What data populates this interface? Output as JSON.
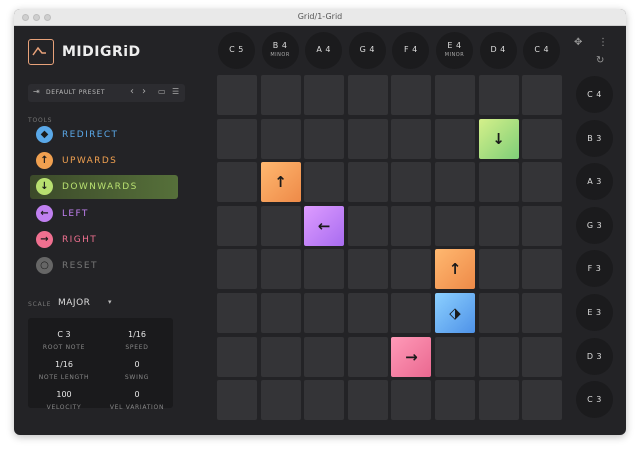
{
  "window": {
    "title": "Grid/1-Grid"
  },
  "app": {
    "logo_text": "MIDIGRiD"
  },
  "preset": {
    "label": "DEFAULT PRESET",
    "prev": "‹",
    "next": "›",
    "save": "▭",
    "menu": "☰",
    "import": "⇥"
  },
  "tools": {
    "label": "TOOLS",
    "items": [
      {
        "label": "REDIRECT",
        "glyph": "◆",
        "color": "#5aa8e8"
      },
      {
        "label": "UPWARDS",
        "glyph": "↑",
        "color": "#f0a050"
      },
      {
        "label": "DOWNWARDS",
        "glyph": "↓",
        "color": "#b8e070"
      },
      {
        "label": "LEFT",
        "glyph": "←",
        "color": "#c080f0"
      },
      {
        "label": "RIGHT",
        "glyph": "→",
        "color": "#f07090"
      },
      {
        "label": "RESET",
        "glyph": "○",
        "color": "#666666"
      }
    ]
  },
  "scale": {
    "label": "SCALE",
    "value": "MAJOR",
    "caret": "▾"
  },
  "params": {
    "root_note": {
      "value": "C 3",
      "label": "ROOT NOTE"
    },
    "speed": {
      "value": "1/16",
      "label": "SPEED"
    },
    "note_length": {
      "value": "1/16",
      "label": "NOTE LENGTH"
    },
    "swing": {
      "value": "0",
      "label": "SWING"
    },
    "velocity": {
      "value": "100",
      "label": "VELOCITY"
    },
    "vel_variation": {
      "value": "0",
      "label": "VEL VARIATION"
    }
  },
  "columns": [
    {
      "note": "C 5",
      "sub": ""
    },
    {
      "note": "B 4",
      "sub": "MINOR"
    },
    {
      "note": "A 4",
      "sub": ""
    },
    {
      "note": "G 4",
      "sub": ""
    },
    {
      "note": "F 4",
      "sub": ""
    },
    {
      "note": "E 4",
      "sub": "MINOR"
    },
    {
      "note": "D 4",
      "sub": ""
    },
    {
      "note": "C 4",
      "sub": ""
    }
  ],
  "rows": [
    "C 4",
    "B 3",
    "A 3",
    "G 3",
    "F 3",
    "E 3",
    "D 3",
    "C 3"
  ],
  "top_icons": {
    "move": "✥",
    "more": "⋮",
    "refresh": "↻"
  },
  "pads": [
    {
      "row": 1,
      "col": 6,
      "glyph": "↓",
      "tool": "downwards",
      "colors": [
        "#d4f08a",
        "#7fce78"
      ]
    },
    {
      "row": 2,
      "col": 1,
      "glyph": "↑",
      "tool": "upwards",
      "colors": [
        "#ffb870",
        "#ee8a48"
      ]
    },
    {
      "row": 3,
      "col": 2,
      "glyph": "←",
      "tool": "left",
      "colors": [
        "#de9cff",
        "#a86cf0"
      ]
    },
    {
      "row": 4,
      "col": 5,
      "glyph": "↑",
      "tool": "upwards",
      "colors": [
        "#ffb870",
        "#ee8a48"
      ]
    },
    {
      "row": 5,
      "col": 5,
      "glyph": "⬗",
      "tool": "redirect",
      "colors": [
        "#8cd0ff",
        "#4e92e8"
      ]
    },
    {
      "row": 6,
      "col": 4,
      "glyph": "→",
      "tool": "right",
      "colors": [
        "#ff9ab8",
        "#ea6890"
      ]
    }
  ]
}
